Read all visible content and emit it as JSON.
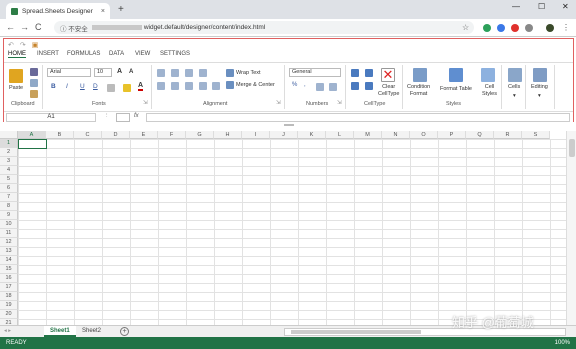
{
  "browser": {
    "tab_title": "Spread.Sheets Designer",
    "tab_close": "×",
    "new_tab": "+",
    "min": "—",
    "max": "☐",
    "close": "✕",
    "back": "←",
    "forward": "→",
    "reload": "C",
    "security": "ⓘ 不安全",
    "url_path": "widget.default/designer/content/index.html",
    "star": "☆",
    "menu": "⋮"
  },
  "ribbon": {
    "tabs": [
      "HOME",
      "INSERT",
      "FORMULAS",
      "DATA",
      "VIEW",
      "SETTINGS"
    ],
    "active_tab": "HOME",
    "groups": {
      "clipboard": "Clipboard",
      "fonts": "Fonts",
      "alignment": "Alignment",
      "numbers": "Numbers",
      "celltype": "CellType",
      "styles": "Styles"
    },
    "paste_label": "Paste",
    "font_name": "Arial",
    "font_size": "10",
    "grow_font": "A",
    "shrink_font": "A",
    "bold": "B",
    "italic": "I",
    "underline": "U",
    "double_underline": "D",
    "font_color_letter": "A",
    "wrap_text": "Wrap Text",
    "merge_center": "Merge & Center",
    "number_format": "General",
    "clear_celltype": "Clear\nCellType",
    "conditional_format": "Condition\nFormat",
    "format_table": "Format Table",
    "cell_styles": "Cell\nStyles",
    "cells": "Cells",
    "editing": "Editing",
    "percent": "%",
    "comma": ","
  },
  "formula_bar": {
    "cell_ref": "A1",
    "fx": "fx",
    "formula": ""
  },
  "grid": {
    "columns": [
      "A",
      "B",
      "C",
      "D",
      "E",
      "F",
      "G",
      "H",
      "I",
      "J",
      "K",
      "L",
      "M",
      "N",
      "O",
      "P",
      "Q",
      "R",
      "S"
    ],
    "rows": [
      "1",
      "2",
      "3",
      "4",
      "5",
      "6",
      "7",
      "8",
      "9",
      "10",
      "11",
      "12",
      "13",
      "14",
      "15",
      "16",
      "17",
      "18",
      "19",
      "20",
      "21"
    ],
    "selected_column": "A",
    "selected_row": "1"
  },
  "sheets": {
    "tabs": [
      "Sheet1",
      "Sheet2"
    ],
    "active": "Sheet1",
    "add_symbol": "+"
  },
  "status": {
    "left": "READY",
    "zoom": "100%"
  },
  "watermark": "知乎 @葡萄城",
  "colors": {
    "accent": "#217346",
    "highlight_frame": "#e06060"
  }
}
